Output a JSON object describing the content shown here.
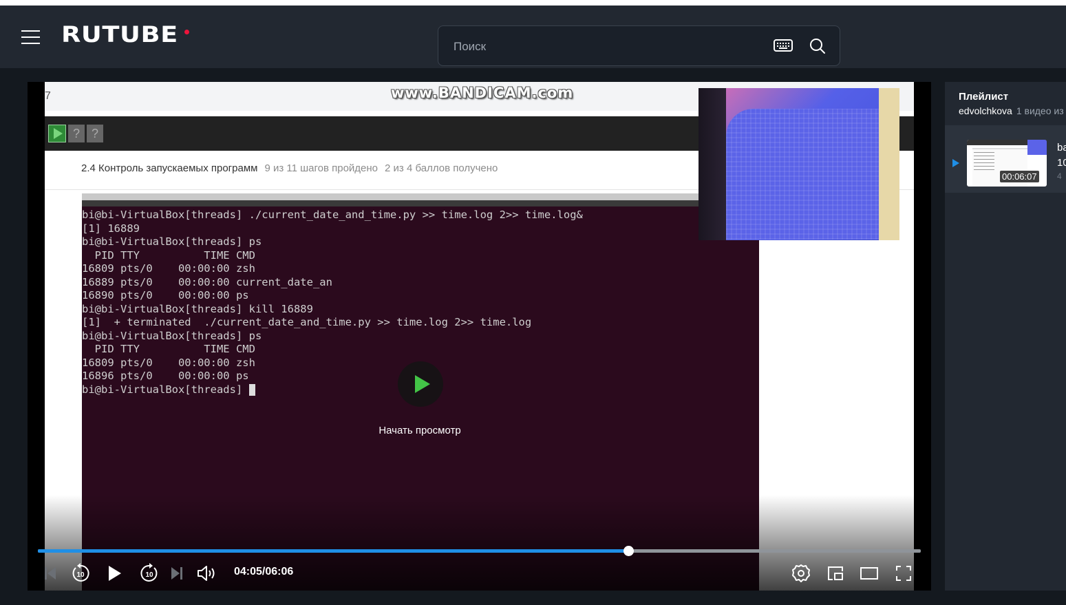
{
  "header": {
    "logo": "RUTUBE",
    "search_placeholder": "Поиск",
    "menu_icon": "hamburger-icon",
    "keyboard_icon": "keyboard-icon",
    "search_icon": "search-icon"
  },
  "video_frame": {
    "corner_number": "7",
    "watermark": "www.BANDICAM.com",
    "toolbar_q1": "?",
    "toolbar_q2": "?",
    "step_title": "2.4 Контроль запускаемых программ",
    "steps_done": "9 из 11 шагов пройдено",
    "points": "2 из 4 баллов  получено",
    "terminal_lines": [
      "bi@bi-VirtualBox[threads] ./current_date_and_time.py >> time.log 2>> time.log&",
      "[1] 16889",
      "bi@bi-VirtualBox[threads] ps",
      "  PID TTY          TIME CMD",
      "16809 pts/0    00:00:00 zsh",
      "16889 pts/0    00:00:00 current_date_an",
      "16890 pts/0    00:00:00 ps",
      "bi@bi-VirtualBox[threads] kill 16889",
      "[1]  + terminated  ./current_date_and_time.py >> time.log 2>> time.log",
      "bi@bi-VirtualBox[threads] ps",
      "  PID TTY          TIME CMD",
      "16809 pts/0    00:00:00 zsh",
      "16896 pts/0    00:00:00 ps",
      "bi@bi-VirtualBox[threads] "
    ]
  },
  "player": {
    "start_label": "Начать просмотр",
    "current_time": "04:05",
    "separator": "/",
    "duration": "06:06",
    "progress_fraction": 0.669,
    "accent_color": "#1f8fe6",
    "rewind_seconds": "10",
    "forward_seconds": "10"
  },
  "playlist": {
    "title": "Плейлист",
    "author": "edvolchkova",
    "count": "1 видео из",
    "items": [
      {
        "duration": "00:06:07",
        "name_line1": "ba",
        "name_line2": "10",
        "meta": "4"
      }
    ]
  }
}
